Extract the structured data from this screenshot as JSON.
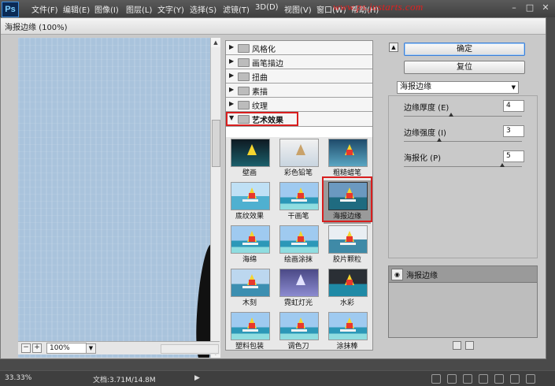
{
  "app": {
    "logo": "Ps",
    "menu": [
      "文件(F)",
      "编辑(E)",
      "图像(I)",
      "图层(L)",
      "文字(Y)",
      "选择(S)",
      "滤镜(T)",
      "3D(D)",
      "视图(V)",
      "窗口(W)",
      "帮助(H)"
    ],
    "watermark": "www.ps.justarts.com"
  },
  "dialog": {
    "title": "海报边缘 (100%)",
    "zoom": "100%",
    "categories": [
      {
        "label": "风格化",
        "expanded": false
      },
      {
        "label": "画笔描边",
        "expanded": false
      },
      {
        "label": "扭曲",
        "expanded": false
      },
      {
        "label": "素描",
        "expanded": false
      },
      {
        "label": "纹理",
        "expanded": false
      },
      {
        "label": "艺术效果",
        "expanded": true
      }
    ],
    "effects": [
      "壁画",
      "彩色铅笔",
      "粗糙蜡笔",
      "底纹效果",
      "干画笔",
      "海报边缘",
      "海绵",
      "绘画涂抹",
      "胶片颗粒",
      "木刻",
      "霓虹灯光",
      "水彩",
      "塑料包装",
      "调色刀",
      "涂抹棒"
    ],
    "selected_effect": "海报边缘",
    "ok_label": "确定",
    "reset_label": "复位",
    "filter_select": "海报边缘",
    "params": [
      {
        "label": "边缘厚度 (E)",
        "value": "4",
        "level": 0.4
      },
      {
        "label": "边缘强度 (I)",
        "value": "3",
        "level": 0.3
      },
      {
        "label": "海报化 (P)",
        "value": "5",
        "level": 0.83
      }
    ],
    "layer_name": "海报边缘"
  },
  "status": {
    "zoom": "33.33%",
    "doc": "文档:3.71M/14.8M"
  }
}
